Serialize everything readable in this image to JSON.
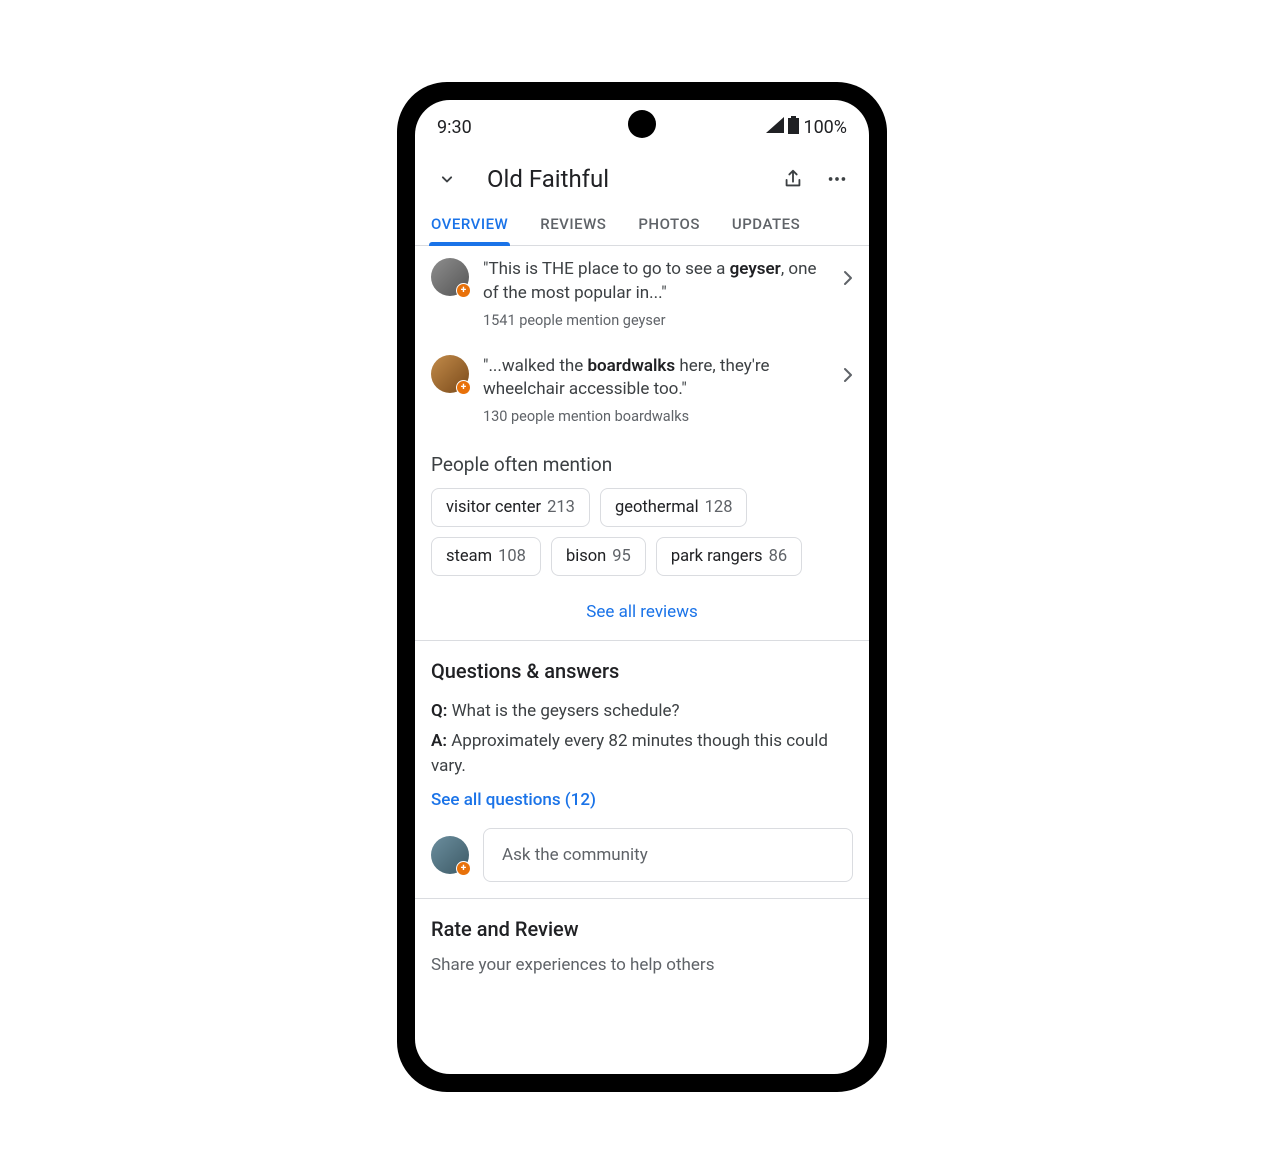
{
  "status": {
    "time": "9:30",
    "battery": "100%"
  },
  "header": {
    "title": "Old Faithful"
  },
  "tabs": [
    {
      "label": "OVERVIEW",
      "active": true
    },
    {
      "label": "REVIEWS",
      "active": false
    },
    {
      "label": "PHOTOS",
      "active": false
    },
    {
      "label": "UPDATES",
      "active": false
    }
  ],
  "snippets": [
    {
      "pre": "\"This is THE place to go to see a ",
      "bold": "geyser",
      "post": ", one of the most popular in...\"",
      "sub": "1541 people mention geyser"
    },
    {
      "pre": "\"...walked the ",
      "bold": "boardwalks",
      "post": " here, they're wheelchair accessible too.\"",
      "sub": "130 people mention boardwalks"
    }
  ],
  "mentions": {
    "title": "People often mention",
    "chips": [
      {
        "label": "visitor center",
        "count": "213"
      },
      {
        "label": "geothermal",
        "count": "128"
      },
      {
        "label": "steam",
        "count": "108"
      },
      {
        "label": "bison",
        "count": "95"
      },
      {
        "label": "park rangers",
        "count": "86"
      }
    ],
    "see_all": "See all reviews"
  },
  "qa": {
    "title": "Questions & answers",
    "q_prefix": "Q:",
    "q_text": " What is the geysers schedule?",
    "a_prefix": "A:",
    "a_text": " Approximately every 82 minutes though this could vary.",
    "see_all": "See all questions (12)",
    "ask_placeholder": "Ask the community"
  },
  "rate": {
    "title": "Rate and Review",
    "sub": "Share your experiences to help others"
  }
}
